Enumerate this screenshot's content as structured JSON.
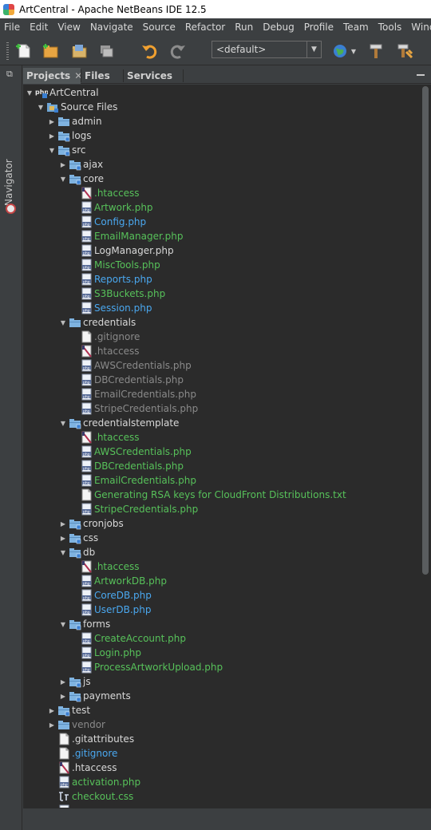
{
  "window": {
    "title": "ArtCentral - Apache NetBeans IDE 12.5"
  },
  "menu": [
    "File",
    "Edit",
    "View",
    "Navigate",
    "Source",
    "Refactor",
    "Run",
    "Debug",
    "Profile",
    "Team",
    "Tools",
    "Window"
  ],
  "toolbar": {
    "buttons": [
      "new-file-icon",
      "new-project-icon",
      "open-project-icon",
      "close-project-icon",
      "undo-icon",
      "redo-icon",
      "browser-icon",
      "build-icon",
      "clean-build-icon"
    ],
    "config_value": "<default>"
  },
  "side_strip": {
    "navigator_label": "Navigator"
  },
  "tabs": [
    {
      "label": "Projects",
      "active": true
    },
    {
      "label": "Files",
      "active": false
    },
    {
      "label": "Services",
      "active": false
    }
  ],
  "tree": [
    {
      "depth": 0,
      "toggle": "open",
      "icon": "php-project",
      "label": "ArtCentral",
      "color": "normal"
    },
    {
      "depth": 1,
      "toggle": "open",
      "icon": "source-folder",
      "label": "Source Files",
      "color": "normal"
    },
    {
      "depth": 2,
      "toggle": "closed",
      "icon": "folder",
      "label": "admin",
      "color": "normal"
    },
    {
      "depth": 2,
      "toggle": "closed",
      "icon": "folder-vcs",
      "label": "logs",
      "color": "normal"
    },
    {
      "depth": 2,
      "toggle": "open",
      "icon": "folder-vcs",
      "label": "src",
      "color": "normal"
    },
    {
      "depth": 3,
      "toggle": "closed",
      "icon": "folder-vcs",
      "label": "ajax",
      "color": "normal"
    },
    {
      "depth": 3,
      "toggle": "open",
      "icon": "folder-vcs",
      "label": "core",
      "color": "normal"
    },
    {
      "depth": 4,
      "toggle": "none",
      "icon": "htaccess",
      "label": ".htaccess",
      "color": "green"
    },
    {
      "depth": 4,
      "toggle": "none",
      "icon": "php-file",
      "label": "Artwork.php",
      "color": "green"
    },
    {
      "depth": 4,
      "toggle": "none",
      "icon": "php-file",
      "label": "Config.php",
      "color": "blue"
    },
    {
      "depth": 4,
      "toggle": "none",
      "icon": "php-file",
      "label": "EmailManager.php",
      "color": "green"
    },
    {
      "depth": 4,
      "toggle": "none",
      "icon": "php-file",
      "label": "LogManager.php",
      "color": "normal"
    },
    {
      "depth": 4,
      "toggle": "none",
      "icon": "php-file",
      "label": "MiscTools.php",
      "color": "green"
    },
    {
      "depth": 4,
      "toggle": "none",
      "icon": "php-file",
      "label": "Reports.php",
      "color": "blue"
    },
    {
      "depth": 4,
      "toggle": "none",
      "icon": "php-file",
      "label": "S3Buckets.php",
      "color": "green"
    },
    {
      "depth": 4,
      "toggle": "none",
      "icon": "php-file",
      "label": "Session.php",
      "color": "blue"
    },
    {
      "depth": 3,
      "toggle": "open",
      "icon": "folder",
      "label": "credentials",
      "color": "normal"
    },
    {
      "depth": 4,
      "toggle": "none",
      "icon": "text-file",
      "label": ".gitignore",
      "color": "gray"
    },
    {
      "depth": 4,
      "toggle": "none",
      "icon": "htaccess",
      "label": ".htaccess",
      "color": "gray"
    },
    {
      "depth": 4,
      "toggle": "none",
      "icon": "php-file",
      "label": "AWSCredentials.php",
      "color": "gray"
    },
    {
      "depth": 4,
      "toggle": "none",
      "icon": "php-file",
      "label": "DBCredentials.php",
      "color": "gray"
    },
    {
      "depth": 4,
      "toggle": "none",
      "icon": "php-file",
      "label": "EmailCredentials.php",
      "color": "gray"
    },
    {
      "depth": 4,
      "toggle": "none",
      "icon": "php-file",
      "label": "StripeCredentials.php",
      "color": "gray"
    },
    {
      "depth": 3,
      "toggle": "open",
      "icon": "folder-vcs",
      "label": "credentialstemplate",
      "color": "normal"
    },
    {
      "depth": 4,
      "toggle": "none",
      "icon": "htaccess",
      "label": ".htaccess",
      "color": "green"
    },
    {
      "depth": 4,
      "toggle": "none",
      "icon": "php-file",
      "label": "AWSCredentials.php",
      "color": "green"
    },
    {
      "depth": 4,
      "toggle": "none",
      "icon": "php-file",
      "label": "DBCredentials.php",
      "color": "green"
    },
    {
      "depth": 4,
      "toggle": "none",
      "icon": "php-file",
      "label": "EmailCredentials.php",
      "color": "green"
    },
    {
      "depth": 4,
      "toggle": "none",
      "icon": "text-file",
      "label": "Generating RSA keys for CloudFront Distributions.txt",
      "color": "green"
    },
    {
      "depth": 4,
      "toggle": "none",
      "icon": "php-file",
      "label": "StripeCredentials.php",
      "color": "green"
    },
    {
      "depth": 3,
      "toggle": "closed",
      "icon": "folder-vcs",
      "label": "cronjobs",
      "color": "normal"
    },
    {
      "depth": 3,
      "toggle": "closed",
      "icon": "folder-vcs",
      "label": "css",
      "color": "normal"
    },
    {
      "depth": 3,
      "toggle": "open",
      "icon": "folder-vcs",
      "label": "db",
      "color": "normal"
    },
    {
      "depth": 4,
      "toggle": "none",
      "icon": "htaccess",
      "label": ".htaccess",
      "color": "green"
    },
    {
      "depth": 4,
      "toggle": "none",
      "icon": "php-file",
      "label": "ArtworkDB.php",
      "color": "green"
    },
    {
      "depth": 4,
      "toggle": "none",
      "icon": "php-file",
      "label": "CoreDB.php",
      "color": "blue"
    },
    {
      "depth": 4,
      "toggle": "none",
      "icon": "php-file",
      "label": "UserDB.php",
      "color": "blue"
    },
    {
      "depth": 3,
      "toggle": "open",
      "icon": "folder-vcs",
      "label": "forms",
      "color": "normal"
    },
    {
      "depth": 4,
      "toggle": "none",
      "icon": "php-file",
      "label": "CreateAccount.php",
      "color": "green"
    },
    {
      "depth": 4,
      "toggle": "none",
      "icon": "php-file",
      "label": "Login.php",
      "color": "green"
    },
    {
      "depth": 4,
      "toggle": "none",
      "icon": "php-file",
      "label": "ProcessArtworkUpload.php",
      "color": "green"
    },
    {
      "depth": 3,
      "toggle": "closed",
      "icon": "folder-vcs",
      "label": "js",
      "color": "normal"
    },
    {
      "depth": 3,
      "toggle": "closed",
      "icon": "folder-vcs",
      "label": "payments",
      "color": "normal"
    },
    {
      "depth": 2,
      "toggle": "closed",
      "icon": "folder-vcs",
      "label": "test",
      "color": "normal"
    },
    {
      "depth": 2,
      "toggle": "closed",
      "icon": "folder",
      "label": "vendor",
      "color": "gray"
    },
    {
      "depth": 2,
      "toggle": "none",
      "icon": "text-file",
      "label": ".gitattributes",
      "color": "normal"
    },
    {
      "depth": 2,
      "toggle": "none",
      "icon": "text-file",
      "label": ".gitignore",
      "color": "blue"
    },
    {
      "depth": 2,
      "toggle": "none",
      "icon": "htaccess",
      "label": ".htaccess",
      "color": "normal"
    },
    {
      "depth": 2,
      "toggle": "none",
      "icon": "php-file",
      "label": "activation.php",
      "color": "green"
    },
    {
      "depth": 2,
      "toggle": "none",
      "icon": "css-file",
      "label": "checkout.css",
      "color": "green"
    },
    {
      "depth": 2,
      "toggle": "none",
      "icon": "php-file",
      "label": "",
      "color": "normal"
    }
  ],
  "colors": {
    "normal": "#d8d8d8",
    "green": "#57c15a",
    "blue": "#4aa8f0",
    "gray": "#8a8a8a"
  }
}
